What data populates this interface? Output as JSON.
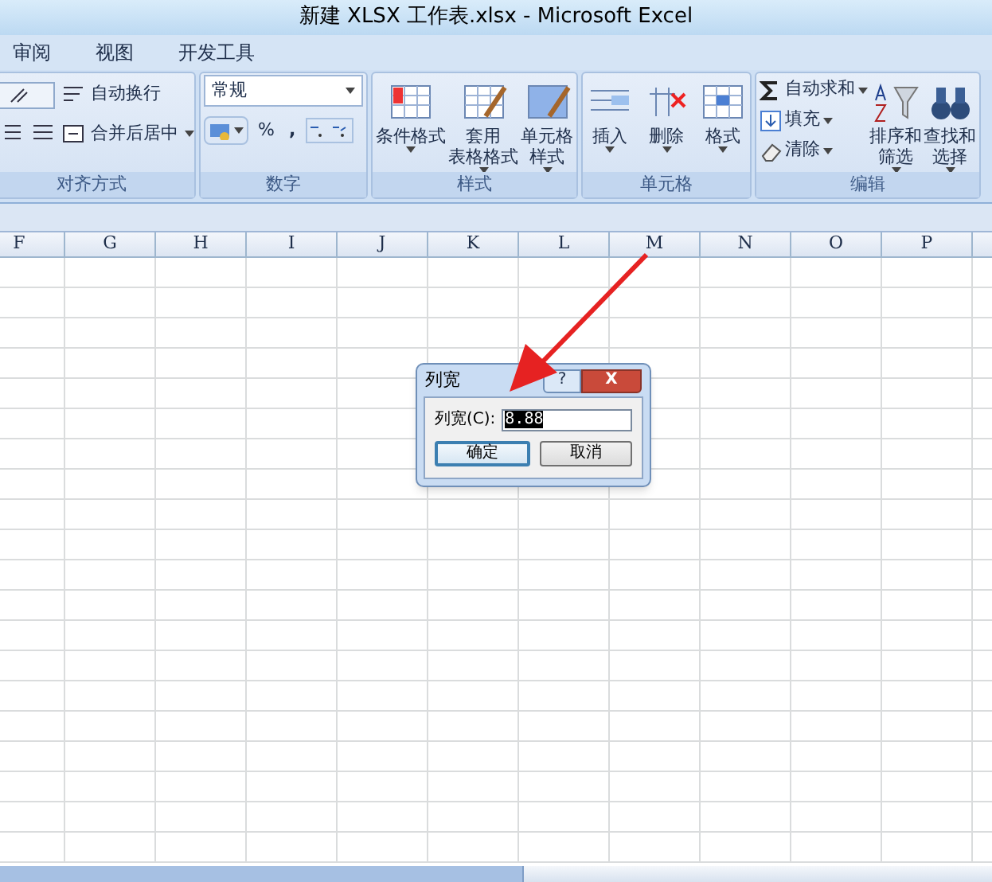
{
  "window": {
    "title": "新建 XLSX 工作表.xlsx - Microsoft Excel"
  },
  "menu_tabs": [
    {
      "label": "审阅",
      "selected": false
    },
    {
      "label": "视图",
      "selected": false
    },
    {
      "label": "开发工具",
      "selected": false
    }
  ],
  "ribbon": {
    "alignment": {
      "label": "对齐方式",
      "wrap_text": "自动换行",
      "merge_center": "合并后居中"
    },
    "number": {
      "label": "数字",
      "format": "常规",
      "percent": "%",
      "comma": ","
    },
    "styles": {
      "label": "样式",
      "buttons": [
        {
          "lines": [
            "条件格式"
          ]
        },
        {
          "lines": [
            "套用",
            "表格格式"
          ]
        },
        {
          "lines": [
            "单元格",
            "样式"
          ]
        }
      ]
    },
    "cells": {
      "label": "单元格",
      "buttons": [
        {
          "lines": [
            "插入"
          ]
        },
        {
          "lines": [
            "删除"
          ]
        },
        {
          "lines": [
            "格式"
          ]
        }
      ]
    },
    "editing": {
      "label": "编辑",
      "small": [
        "自动求和",
        "填充",
        "清除"
      ],
      "buttons": [
        {
          "lines": [
            "排序和",
            "筛选"
          ]
        },
        {
          "lines": [
            "查找和",
            "选择"
          ]
        }
      ]
    }
  },
  "columns": [
    "F",
    "G",
    "H",
    "I",
    "J",
    "K",
    "L",
    "M",
    "N",
    "O",
    "P"
  ],
  "dialog": {
    "title": "列宽",
    "help": "?",
    "close": "X",
    "field_label": "列宽(C):",
    "field_value": "8.88",
    "ok": "确定",
    "cancel": "取消"
  }
}
